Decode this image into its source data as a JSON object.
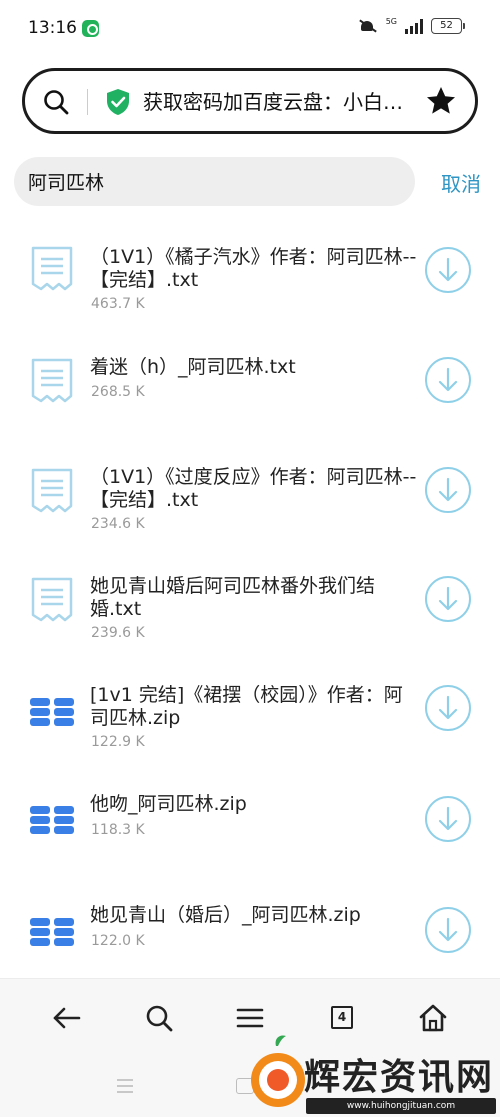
{
  "status_bar": {
    "time": "13:16",
    "network": "5G",
    "battery": "52"
  },
  "address_bar": {
    "title": "获取密码加百度云盘：小白爱分享",
    "shield_color": "#20b163",
    "icons": [
      "search-icon",
      "shield-icon",
      "star-icon"
    ]
  },
  "search": {
    "value": "阿司匹林",
    "cancel_label": "取消"
  },
  "files": [
    {
      "name": "（1V1）《橘子汽水》作者：阿司匹林--【完结】.txt",
      "size": "463.7 K",
      "type": "txt"
    },
    {
      "name": "着迷（h）_阿司匹林.txt",
      "size": "268.5 K",
      "type": "txt"
    },
    {
      "name": "（1V1）《过度反应》作者：阿司匹林--【完结】.txt",
      "size": "234.6 K",
      "type": "txt"
    },
    {
      "name": "她见青山婚后阿司匹林番外我们结婚.txt",
      "size": "239.6 K",
      "type": "txt"
    },
    {
      "name": "[1v1 完结]《裙摆（校园）》作者：阿司匹林.zip",
      "size": "122.9 K",
      "type": "zip"
    },
    {
      "name": "他吻_阿司匹林.zip",
      "size": "118.3 K",
      "type": "zip"
    },
    {
      "name": "她见青山（婚后）_阿司匹林.zip",
      "size": "122.0 K",
      "type": "zip"
    }
  ],
  "toolbar": {
    "tab_count": "4",
    "icons": [
      "back-arrow-icon",
      "search-icon",
      "menu-icon",
      "tabs-icon",
      "home-icon"
    ]
  },
  "watermark": {
    "brand": "辉宏资讯网",
    "domain": "www.huihongjituan.com"
  },
  "colors": {
    "accent": "#2e95c4",
    "txt_icon": "#a9d6ea",
    "zip_icon": "#3a7fe6",
    "download_circle": "#8fd0e8"
  }
}
